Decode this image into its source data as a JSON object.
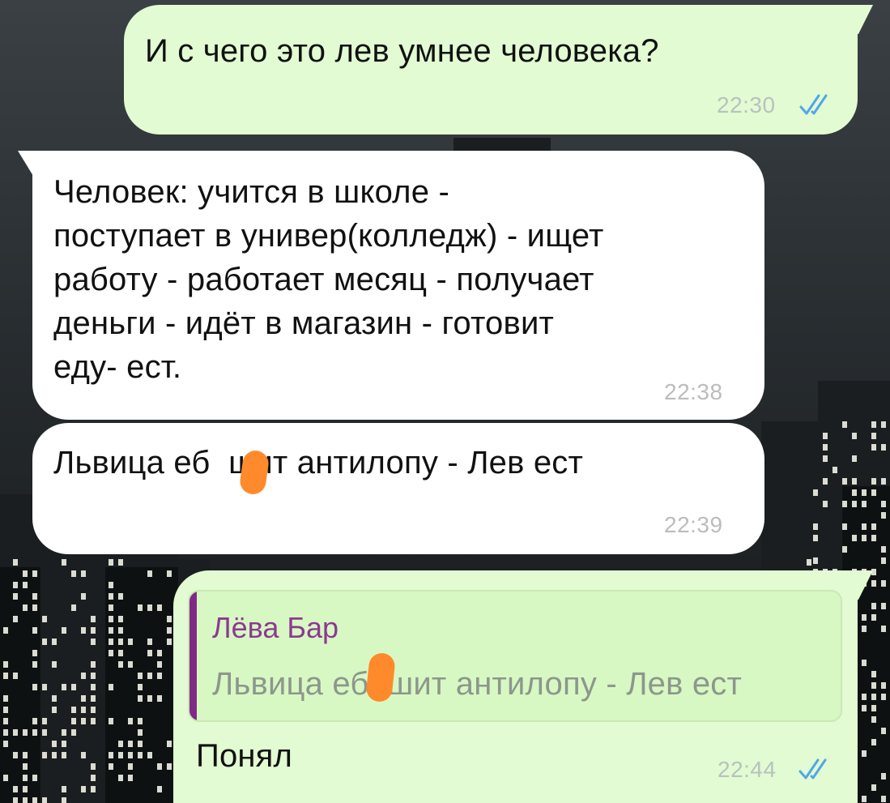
{
  "colors": {
    "outgoing_bubble": "#e2fbd2",
    "incoming_bubble": "#ffffff",
    "reply_bar": "#7f2b86",
    "reply_author": "#8a3b8f",
    "read_ticks": "#4fa8e6",
    "censor_blob": "#ff8a2c"
  },
  "messages": [
    {
      "direction": "outgoing",
      "text": "И с чего это лев умнее человека?",
      "time": "22:30",
      "status_icon": "double-check-icon"
    },
    {
      "direction": "incoming",
      "text_lines": [
        "Человек: учится  в школе -",
        "поступает в универ(колледж) - ищет",
        "работу - работает месяц - получает",
        "деньги - идёт в магазин - готовит",
        "еду- ест."
      ],
      "time": "22:38"
    },
    {
      "direction": "incoming",
      "text": "Львица еб  шит антилопу - Лев ест",
      "time": "22:39"
    },
    {
      "direction": "outgoing",
      "reply": {
        "author": "Лёва Бар",
        "text": "Львица еб  шит антилопу - Лев ест"
      },
      "text": "Понял",
      "time": "22:44",
      "status_icon": "double-check-icon"
    }
  ]
}
